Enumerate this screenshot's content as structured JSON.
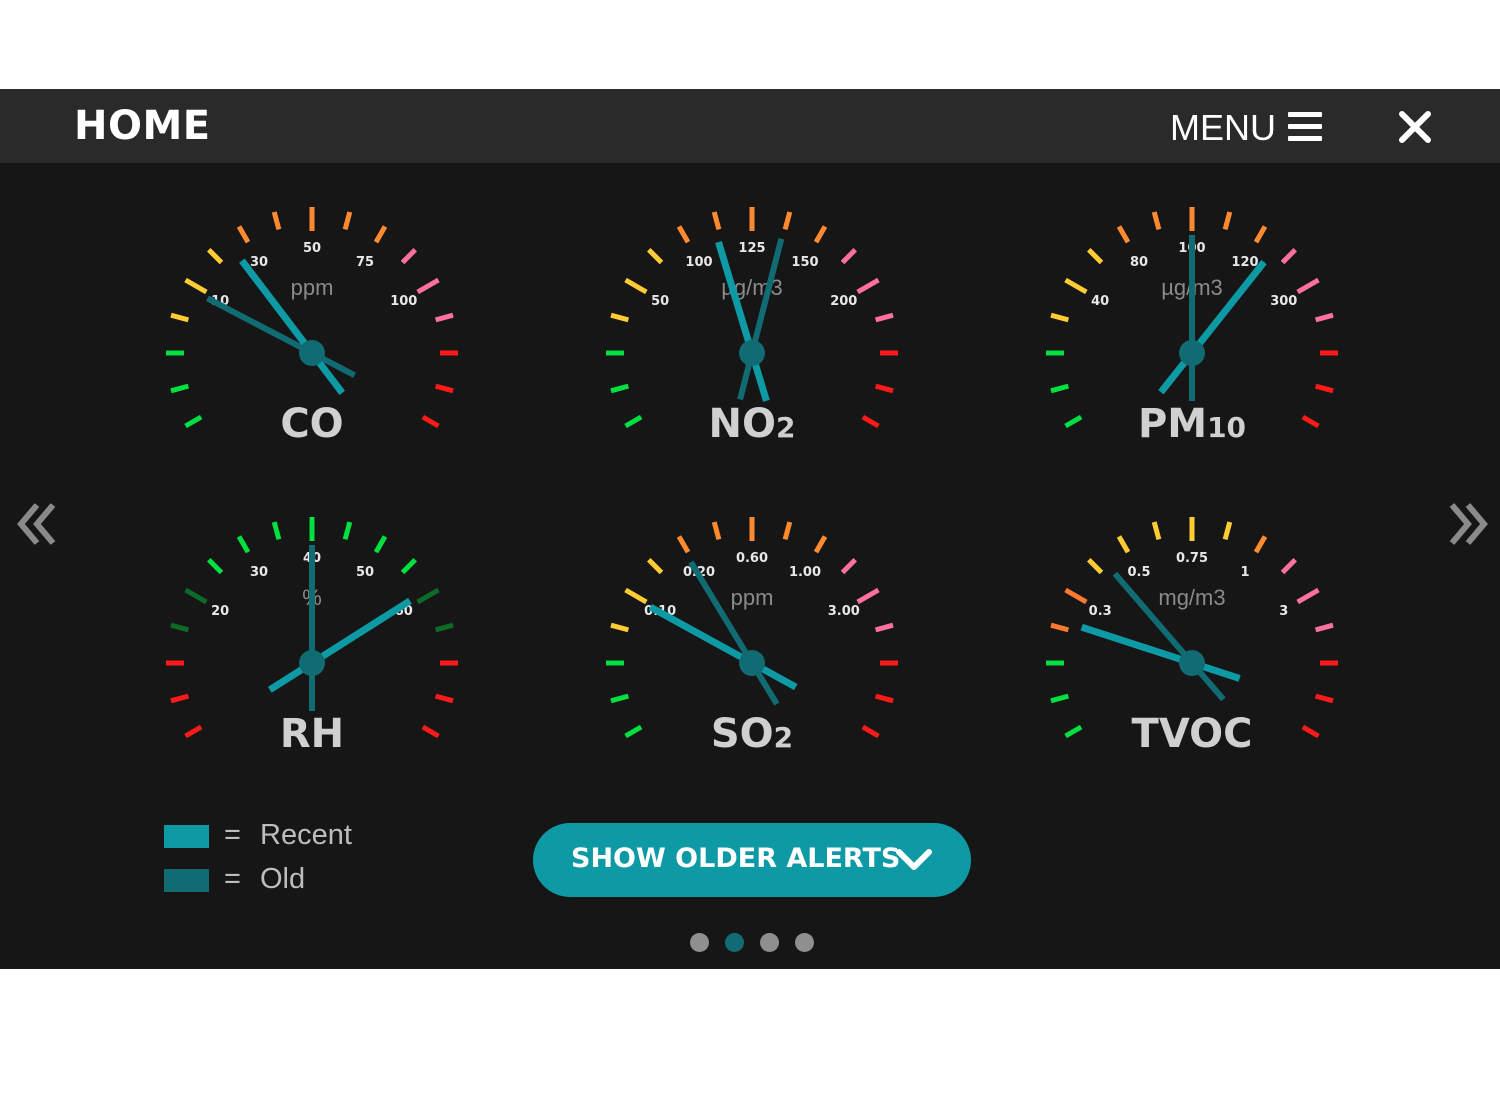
{
  "header": {
    "title": "HOME",
    "menu_label": "MENU"
  },
  "colors": {
    "accent": "#0e9aa5",
    "recent": "#0e9aa5",
    "old": "#116b72",
    "panel": "#161616",
    "topbar": "#2a2a2a"
  },
  "icons": {
    "menu": "hamburger-menu-icon",
    "close": "close-icon",
    "prev": "double-chevron-left-icon",
    "next": "double-chevron-right-icon",
    "alerts_chevron": "chevron-down-icon"
  },
  "gauges": [
    {
      "name_main": "CO",
      "name_sub": "",
      "unit": "ppm",
      "labels": [
        "10",
        "30",
        "50",
        "75",
        "100"
      ],
      "tick_colors": [
        "#00e040",
        "#00e040",
        "#00e040",
        "#ffcc33",
        "#ffcc33",
        "#ffcc33",
        "#ff8a30",
        "#ff8a30",
        "#ff8a30",
        "#ff8a30",
        "#ff8a30",
        "#ff70a0",
        "#ff70a0",
        "#ff70a0",
        "#ff1a1a",
        "#ff1a1a",
        "#ff1a1a"
      ],
      "recent_needle_fraction": 0.345,
      "old_needle_fraction": 0.24
    },
    {
      "name_main": "NO",
      "name_sub": "2",
      "unit": "µg/m3",
      "labels": [
        "50",
        "100",
        "125",
        "150",
        "200"
      ],
      "tick_colors": [
        "#00e040",
        "#00e040",
        "#00e040",
        "#ffcc33",
        "#ffcc33",
        "#ffcc33",
        "#ff8a30",
        "#ff8a30",
        "#ff8a30",
        "#ff8a30",
        "#ff8a30",
        "#ff70a0",
        "#ff70a0",
        "#ff70a0",
        "#ff1a1a",
        "#ff1a1a",
        "#ff1a1a"
      ],
      "recent_needle_fraction": 0.43,
      "old_needle_fraction": 0.56
    },
    {
      "name_main": "PM",
      "name_sub": "10",
      "unit": "µg/m3",
      "labels": [
        "40",
        "80",
        "100",
        "120",
        "300"
      ],
      "tick_colors": [
        "#00e040",
        "#00e040",
        "#00e040",
        "#ffcc33",
        "#ffcc33",
        "#ffcc33",
        "#ff8a30",
        "#ff8a30",
        "#ff8a30",
        "#ff8a30",
        "#ff8a30",
        "#ff70a0",
        "#ff70a0",
        "#ff70a0",
        "#ff1a1a",
        "#ff1a1a",
        "#ff1a1a"
      ],
      "recent_needle_fraction": 0.66,
      "old_needle_fraction": 0.5
    },
    {
      "name_main": "RH",
      "name_sub": "",
      "unit": "%",
      "labels": [
        "20",
        "30",
        "40",
        "50",
        "60"
      ],
      "tick_colors": [
        "#ff1a1a",
        "#ff1a1a",
        "#ff1a1a",
        "#0d6b28",
        "#0d6b28",
        "#00e040",
        "#00e040",
        "#00e040",
        "#00e040",
        "#00e040",
        "#00e040",
        "#00e040",
        "#0d6b28",
        "#0d6b28",
        "#ff1a1a",
        "#ff1a1a",
        "#ff1a1a"
      ],
      "recent_needle_fraction": 0.74,
      "old_needle_fraction": 0.5
    },
    {
      "name_main": "SO",
      "name_sub": "2",
      "unit": "ppm",
      "labels": [
        "0.10",
        "0.20",
        "0.60",
        "1.00",
        "3.00"
      ],
      "tick_colors": [
        "#00e040",
        "#00e040",
        "#00e040",
        "#ffcc33",
        "#ffcc33",
        "#ffcc33",
        "#ff8a30",
        "#ff8a30",
        "#ff8a30",
        "#ff8a30",
        "#ff8a30",
        "#ff70a0",
        "#ff70a0",
        "#ff70a0",
        "#ff1a1a",
        "#ff1a1a",
        "#ff1a1a"
      ],
      "recent_needle_fraction": 0.245,
      "old_needle_fraction": 0.37
    },
    {
      "name_main": "TVOC",
      "name_sub": "",
      "unit": "mg/m3",
      "labels": [
        "0.3",
        "0.5",
        "0.75",
        "1",
        "3"
      ],
      "tick_colors": [
        "#00e040",
        "#00e040",
        "#00e040",
        "#ff7a30",
        "#ff7a30",
        "#ffcc33",
        "#ffcc33",
        "#ffcc33",
        "#ffcc33",
        "#ffcc33",
        "#ff8a30",
        "#ff70a0",
        "#ff70a0",
        "#ff70a0",
        "#ff1a1a",
        "#ff1a1a",
        "#ff1a1a"
      ],
      "recent_needle_fraction": 0.2,
      "old_needle_fraction": 0.33
    }
  ],
  "legend": {
    "eq": "=",
    "recent_label": "Recent",
    "old_label": "Old"
  },
  "alerts_button": {
    "label": "SHOW OLDER ALERTS"
  },
  "pagination": {
    "pages": 4,
    "active_index": 1,
    "active_color": "#116b72",
    "inactive_color": "#8f8f8f"
  }
}
